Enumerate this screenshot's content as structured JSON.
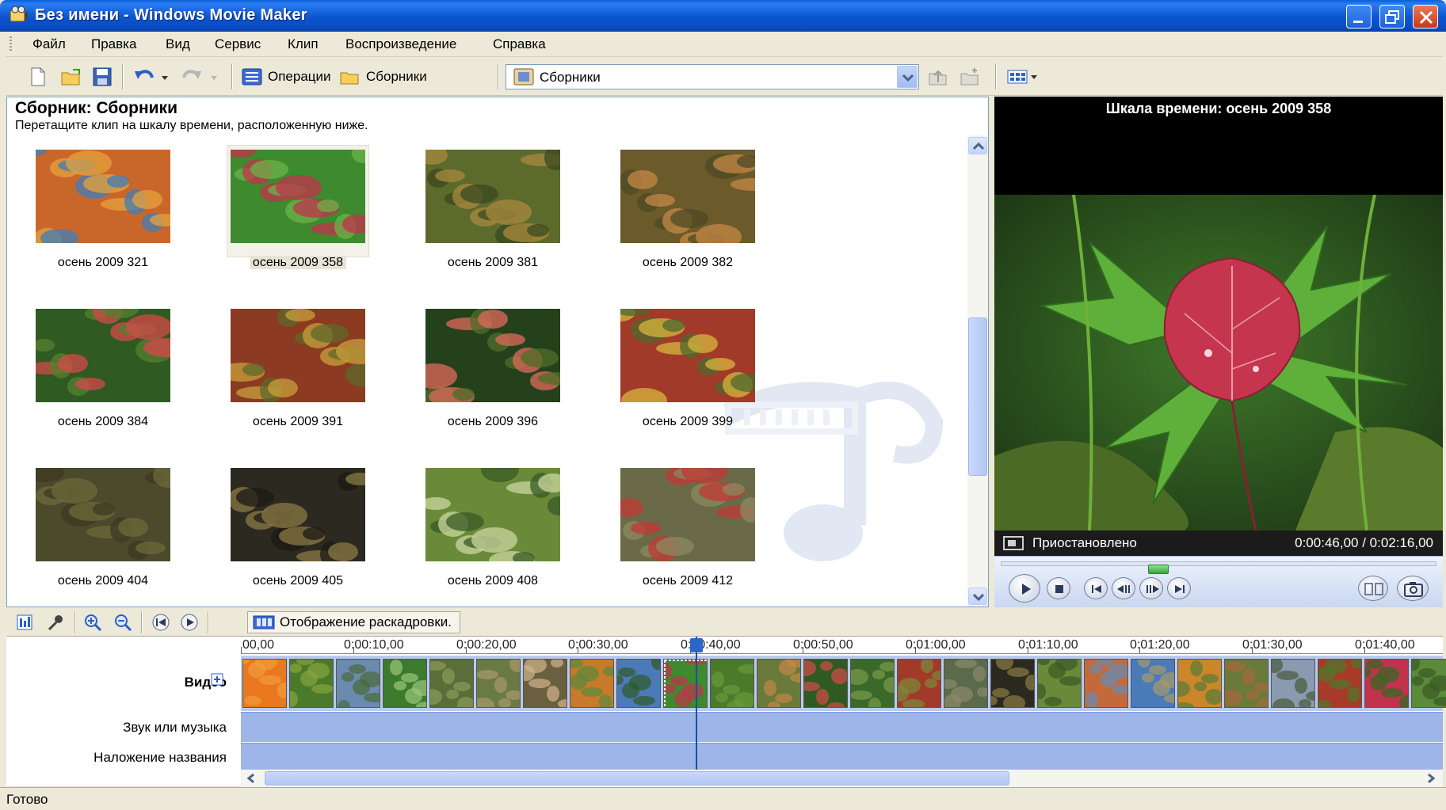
{
  "window": {
    "title": "Без имени - Windows Movie Maker",
    "titlebar_color": "#0a52cf"
  },
  "menu": {
    "items": [
      "Файл",
      "Правка",
      "Вид",
      "Сервис",
      "Клип",
      "Воспроизведение",
      "Справка"
    ]
  },
  "toolbar": {
    "operations_label": "Операции",
    "collections_label": "Сборники",
    "combo_value": "Сборники"
  },
  "collection": {
    "title": "Сборник: Сборники",
    "subtitle": "Перетащите клип на шкалу времени, расположенную ниже.",
    "clips": [
      {
        "label": "осень 2009 321",
        "colors": [
          "#c9672a",
          "#e6a13d",
          "#3f7db8"
        ],
        "selected": false
      },
      {
        "label": "осень 2009 358",
        "colors": [
          "#3e8a2e",
          "#c1334c",
          "#6bb34a"
        ],
        "selected": true
      },
      {
        "label": "осень 2009 381",
        "colors": [
          "#5c6a2c",
          "#a88a3d",
          "#3b4a1f"
        ],
        "selected": false
      },
      {
        "label": "осень 2009 382",
        "colors": [
          "#6b5a2a",
          "#c48845",
          "#4d4a25"
        ],
        "selected": false
      },
      {
        "label": "осень 2009 384",
        "colors": [
          "#2f5a22",
          "#d44a4a",
          "#55802f"
        ],
        "selected": false
      },
      {
        "label": "осень 2009 391",
        "colors": [
          "#8c3a22",
          "#c7a03b",
          "#5e6a2a"
        ],
        "selected": false
      },
      {
        "label": "осень 2009 396",
        "colors": [
          "#24411c",
          "#e06a5a",
          "#4e6e2a"
        ],
        "selected": false
      },
      {
        "label": "осень 2009 399",
        "colors": [
          "#a23a2a",
          "#d6b53e",
          "#4c6a2c"
        ],
        "selected": false
      },
      {
        "label": "осень 2009 404",
        "colors": [
          "#4b4a2c",
          "#6e6a3a",
          "#3c3a22"
        ],
        "selected": false
      },
      {
        "label": "осень 2009 405",
        "colors": [
          "#2c2a20",
          "#8a7a44",
          "#1c1a14"
        ],
        "selected": false
      },
      {
        "label": "осень 2009 408",
        "colors": [
          "#6a8a3a",
          "#c9d7a0",
          "#3a5a24"
        ],
        "selected": false
      },
      {
        "label": "осень 2009 412",
        "colors": [
          "#6a6a48",
          "#c33a34",
          "#8a8a60"
        ],
        "selected": false
      }
    ]
  },
  "monitor": {
    "title": "Шкала времени: осень 2009 358",
    "status": "Приостановлено",
    "time": "0:00:46,00 / 0:02:16,00",
    "progress_fraction": 0.338
  },
  "storyboard": {
    "mode_label": "Отображение раскадровки."
  },
  "timeline": {
    "ticks": [
      "00,00",
      "0:00:10,00",
      "0:00:20,00",
      "0:00:30,00",
      "0:00:40,00",
      "0:00:50,00",
      "0:01:00,00",
      "0:01:10,00",
      "0:01:20,00",
      "0:01:30,00",
      "0:01:40,00"
    ],
    "video_label": "Видео",
    "audio_label": "Звук или музыка",
    "title_label": "Наложение названия",
    "clips": [
      {
        "colors": [
          "#e8791f",
          "#f29b3a"
        ]
      },
      {
        "colors": [
          "#4a7a2a",
          "#86a43e"
        ]
      },
      {
        "colors": [
          "#6a8ab0",
          "#4a6a3a"
        ]
      },
      {
        "colors": [
          "#3c7a2e",
          "#9ac67a"
        ]
      },
      {
        "colors": [
          "#5a6e3a",
          "#8a9a5a"
        ]
      },
      {
        "colors": [
          "#6a7a44",
          "#a89a6a"
        ]
      },
      {
        "colors": [
          "#6a6040",
          "#d2b58a"
        ]
      },
      {
        "colors": [
          "#c77a2a",
          "#5a8a3a"
        ]
      },
      {
        "colors": [
          "#4a7ab8",
          "#2f5a24"
        ]
      },
      {
        "colors": [
          "#3e8a2e",
          "#c1334c"
        ]
      },
      {
        "colors": [
          "#4a7a2a",
          "#6a9a3a"
        ]
      },
      {
        "colors": [
          "#6a7a3a",
          "#c48845"
        ]
      },
      {
        "colors": [
          "#2f5a22",
          "#d44a4a"
        ]
      },
      {
        "colors": [
          "#3a6a2a",
          "#7a9a4a"
        ]
      },
      {
        "colors": [
          "#a23a2a",
          "#7a8a3a"
        ]
      },
      {
        "colors": [
          "#5a6a4a",
          "#8a8a6a"
        ]
      },
      {
        "colors": [
          "#2c2a20",
          "#8a7a44"
        ]
      },
      {
        "colors": [
          "#6a8a3a",
          "#3a5a24"
        ]
      },
      {
        "colors": [
          "#c46a3a",
          "#6a8ab0"
        ]
      },
      {
        "colors": [
          "#4a7ab8",
          "#a89a6a"
        ]
      },
      {
        "colors": [
          "#c9872a",
          "#5a7a3a"
        ]
      },
      {
        "colors": [
          "#6a7a3a",
          "#a8683a"
        ]
      },
      {
        "colors": [
          "#8a9ab0",
          "#4a5a3a"
        ]
      },
      {
        "colors": [
          "#a83a2a",
          "#4a7a2a"
        ]
      },
      {
        "colors": [
          "#c1334c",
          "#2f6a22"
        ]
      },
      {
        "colors": [
          "#5a8a3a",
          "#3a5a24"
        ]
      }
    ],
    "playhead_seconds": 40.5
  },
  "statusbar": {
    "text": "Готово"
  }
}
